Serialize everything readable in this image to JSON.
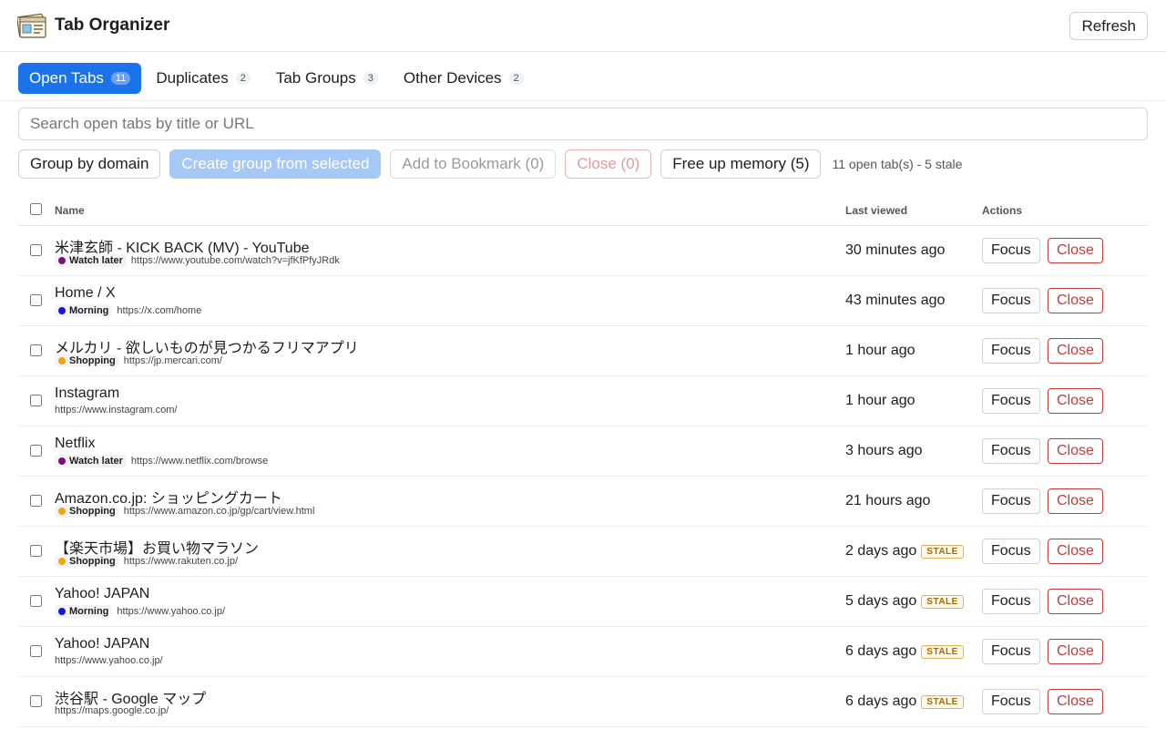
{
  "header": {
    "title": "Tab Organizer",
    "refresh_label": "Refresh"
  },
  "tabs": [
    {
      "label": "Open Tabs",
      "count": "11",
      "active": true
    },
    {
      "label": "Duplicates",
      "count": "2"
    },
    {
      "label": "Tab Groups",
      "count": "3"
    },
    {
      "label": "Other Devices",
      "count": "2"
    }
  ],
  "search": {
    "placeholder": "Search open tabs by title or URL"
  },
  "toolbar": {
    "group_by_domain": "Group by domain",
    "create_group": "Create group from selected",
    "add_bookmark": "Add to Bookmark (0)",
    "close_selected": "Close (0)",
    "free_memory": "Free up memory (5)",
    "status": "11 open tab(s) - 5 stale"
  },
  "table": {
    "headers": {
      "name": "Name",
      "last_viewed": "Last viewed",
      "actions": "Actions"
    },
    "focus_label": "Focus",
    "close_label": "Close",
    "stale_label": "STALE",
    "group_colors": {
      "Watch later": "#7b0f7b",
      "Morning": "#1515d6",
      "Shopping": "#f2a20c"
    },
    "rows": [
      {
        "title": "米津玄師 - KICK BACK (MV) - YouTube",
        "group": "Watch later",
        "url": "https://www.youtube.com/watch?v=jfKfPfyJRdk",
        "last": "30 minutes ago",
        "stale": false
      },
      {
        "title": "Home / X",
        "group": "Morning",
        "url": "https://x.com/home",
        "last": "43 minutes ago",
        "stale": false
      },
      {
        "title": "メルカリ - 欲しいものが見つかるフリマアプリ",
        "group": "Shopping",
        "url": "https://jp.mercari.com/",
        "last": "1 hour ago",
        "stale": false
      },
      {
        "title": "Instagram",
        "group": "",
        "url": "https://www.instagram.com/",
        "last": "1 hour ago",
        "stale": false
      },
      {
        "title": "Netflix",
        "group": "Watch later",
        "url": "https://www.netflix.com/browse",
        "last": "3 hours ago",
        "stale": false
      },
      {
        "title": "Amazon.co.jp: ショッピングカート",
        "group": "Shopping",
        "url": "https://www.amazon.co.jp/gp/cart/view.html",
        "last": "21 hours ago",
        "stale": false
      },
      {
        "title": "【楽天市場】お買い物マラソン",
        "group": "Shopping",
        "url": "https://www.rakuten.co.jp/",
        "last": "2 days ago",
        "stale": true
      },
      {
        "title": "Yahoo! JAPAN",
        "group": "Morning",
        "url": "https://www.yahoo.co.jp/",
        "last": "5 days ago",
        "stale": true
      },
      {
        "title": "Yahoo! JAPAN",
        "group": "",
        "url": "https://www.yahoo.co.jp/",
        "last": "6 days ago",
        "stale": true
      },
      {
        "title": "渋谷駅 - Google マップ",
        "group": "",
        "url": "https://maps.google.co.jp/",
        "last": "6 days ago",
        "stale": true
      }
    ]
  }
}
